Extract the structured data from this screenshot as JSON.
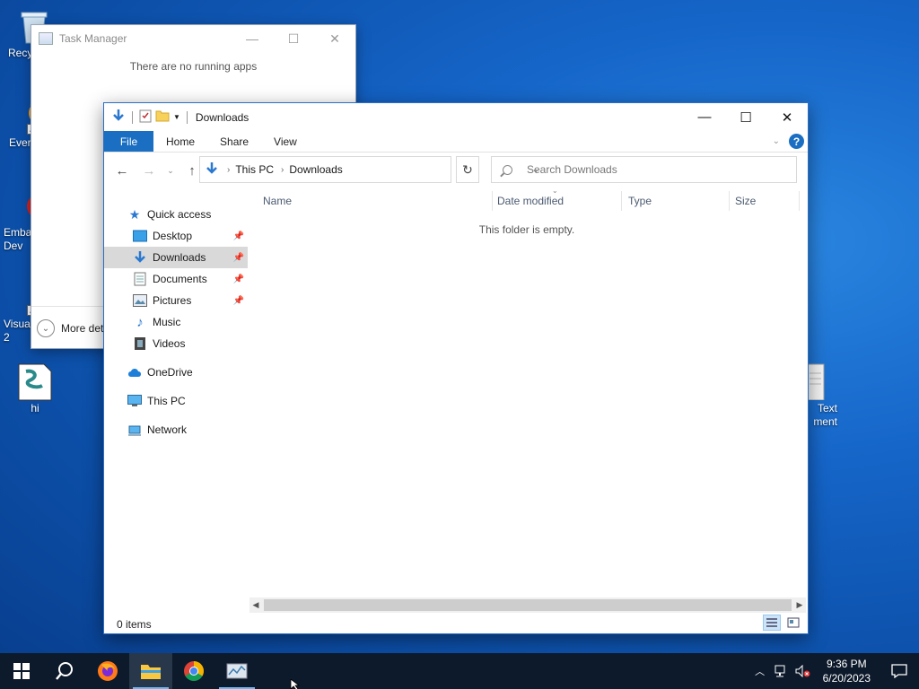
{
  "desktop": {
    "icons": [
      {
        "label": "Recy"
      },
      {
        "label": "Ever"
      },
      {
        "label": "Emba\nDev"
      },
      {
        "label": "Visua\n2"
      },
      {
        "label": "hi"
      },
      {
        "label": "Text\nment"
      }
    ]
  },
  "task_manager": {
    "title": "Task Manager",
    "message": "There are no running apps",
    "more_details": "More det"
  },
  "explorer": {
    "title": "Downloads",
    "ribbon": {
      "file": "File",
      "home": "Home",
      "share": "Share",
      "view": "View"
    },
    "address": {
      "crumb1": "This PC",
      "crumb2": "Downloads"
    },
    "search_placeholder": "Search Downloads",
    "nav": {
      "quick_access": "Quick access",
      "desktop": "Desktop",
      "downloads": "Downloads",
      "documents": "Documents",
      "pictures": "Pictures",
      "music": "Music",
      "videos": "Videos",
      "onedrive": "OneDrive",
      "this_pc": "This PC",
      "network": "Network"
    },
    "columns": {
      "name": "Name",
      "date": "Date modified",
      "type": "Type",
      "size": "Size"
    },
    "empty_message": "This folder is empty.",
    "status": "0 items"
  },
  "taskbar": {
    "time": "9:36 PM",
    "date": "6/20/2023"
  },
  "colors": {
    "accent": "#1a6fc2",
    "taskbar": "#0d1a2b"
  }
}
